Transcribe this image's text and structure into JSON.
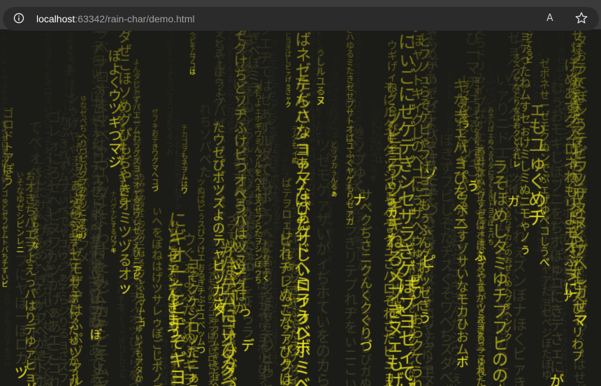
{
  "browser": {
    "address": {
      "host": "localhost",
      "rest": ":63342/rain-char/demo.html"
    },
    "icons": {
      "site_info": "info-circle-icon",
      "read_aloud": "read-aloud-icon",
      "favorite": "star-icon"
    },
    "read_aloud_label": "A",
    "colors": {
      "titlebar": "#3b3b3b",
      "addressbar": "#2b2b2b",
      "url_host": "#ffffff",
      "url_rest": "#a0a0a0"
    }
  },
  "page": {
    "name": "character-rain-canvas",
    "charset": "あいうえおかきくけこさしすせそたちつてとなにぬねのはひふへほまみむめもやゆよらりるれろわをんがぎぐげござじずぜぞだぢづでどばびぶべぼぱぴぷぺぽぁぃぅぇぉゃゅょっアイウエオカキクケコサシスセソタチツテトナニヌネノハヒフヘホマミムメモヤユヨラリルレロワヲンガギグゲゴザジズゼゾダヂヅデドバビブベボパピプペポァィゥェォャュョッー",
    "colors": {
      "background": "#1b1b17",
      "bright": "#f2ec1a",
      "mid": "#b8b21a",
      "dim": "#4a4a2a",
      "faint": "#34342a"
    }
  }
}
